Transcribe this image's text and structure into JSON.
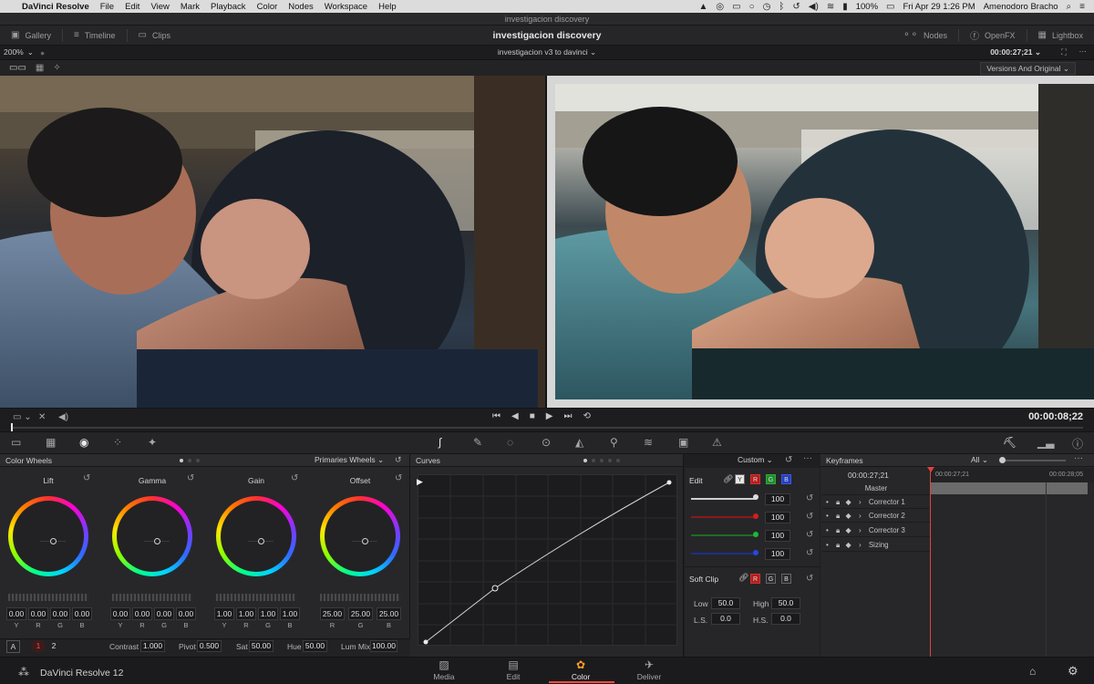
{
  "menubar": {
    "apple": "",
    "app": "DaVinci Resolve",
    "items": [
      "File",
      "Edit",
      "View",
      "Mark",
      "Playback",
      "Color",
      "Nodes",
      "Workspace",
      "Help"
    ],
    "battery": "100%",
    "datetime": "Fri Apr 29  1:26 PM",
    "user": "Amenodoro Bracho"
  },
  "window": {
    "title": "investigacion discovery"
  },
  "toolbar": {
    "gallery": "Gallery",
    "timeline": "Timeline",
    "clips": "Clips",
    "project_title": "investigacion discovery",
    "nodes": "Nodes",
    "openfx": "OpenFX",
    "lightbox": "Lightbox"
  },
  "viewer": {
    "zoom": "200%",
    "timeline_name": "investigacion v3 to davinci",
    "timecode": "00:00:27;21",
    "versions": "Versions And Original",
    "playhead_timecode": "00:00:08;22"
  },
  "color_wheels": {
    "title": "Color Wheels",
    "mode": "Primaries Wheels",
    "wheels": [
      {
        "name": "Lift",
        "values": [
          "0.00",
          "0.00",
          "0.00",
          "0.00"
        ],
        "channels": [
          "Y",
          "R",
          "G",
          "B"
        ]
      },
      {
        "name": "Gamma",
        "values": [
          "0.00",
          "0.00",
          "0.00",
          "0.00"
        ],
        "channels": [
          "Y",
          "R",
          "G",
          "B"
        ]
      },
      {
        "name": "Gain",
        "values": [
          "1.00",
          "1.00",
          "1.00",
          "1.00"
        ],
        "channels": [
          "Y",
          "R",
          "G",
          "B"
        ]
      },
      {
        "name": "Offset",
        "values": [
          "25.00",
          "25.00",
          "25.00"
        ],
        "channels": [
          "R",
          "G",
          "B"
        ]
      }
    ]
  },
  "params": {
    "a_label": "A",
    "page1": "1",
    "page2": "2",
    "contrast_label": "Contrast",
    "contrast": "1.000",
    "pivot_label": "Pivot",
    "pivot": "0.500",
    "sat_label": "Sat",
    "sat": "50.00",
    "hue_label": "Hue",
    "hue": "50.00",
    "lummix_label": "Lum Mix",
    "lummix": "100.00"
  },
  "curves": {
    "title": "Curves",
    "mode": "Custom",
    "edit_label": "Edit",
    "chips": [
      "Y",
      "R",
      "G",
      "B"
    ],
    "intensities": [
      "100",
      "100",
      "100",
      "100"
    ],
    "softclip_label": "Soft Clip",
    "softclip_chips": [
      "R",
      "G",
      "B"
    ],
    "low_label": "Low",
    "low": "50.0",
    "high_label": "High",
    "high": "50.0",
    "ls_label": "L.S.",
    "ls": "0.0",
    "hs_label": "H.S.",
    "hs": "0.0",
    "line_colors": [
      "#cfcfcf",
      "#d11f1f",
      "#1fb83a",
      "#2747e0"
    ]
  },
  "keyframes": {
    "title": "Keyframes",
    "filter": "All",
    "timecode": "00:00:27;21",
    "ruler_start": "00:00:27;21",
    "ruler_end": "00:00:28;05",
    "tracks": [
      "Master",
      "Corrector 1",
      "Corrector 2",
      "Corrector 3",
      "Sizing"
    ]
  },
  "bottom": {
    "product": "DaVinci Resolve 12",
    "pages": [
      "Media",
      "Edit",
      "Color",
      "Deliver"
    ],
    "active_page": "Color"
  },
  "colors": {
    "accent_red": "#e0433b",
    "active_page": "#ff4a3d"
  }
}
